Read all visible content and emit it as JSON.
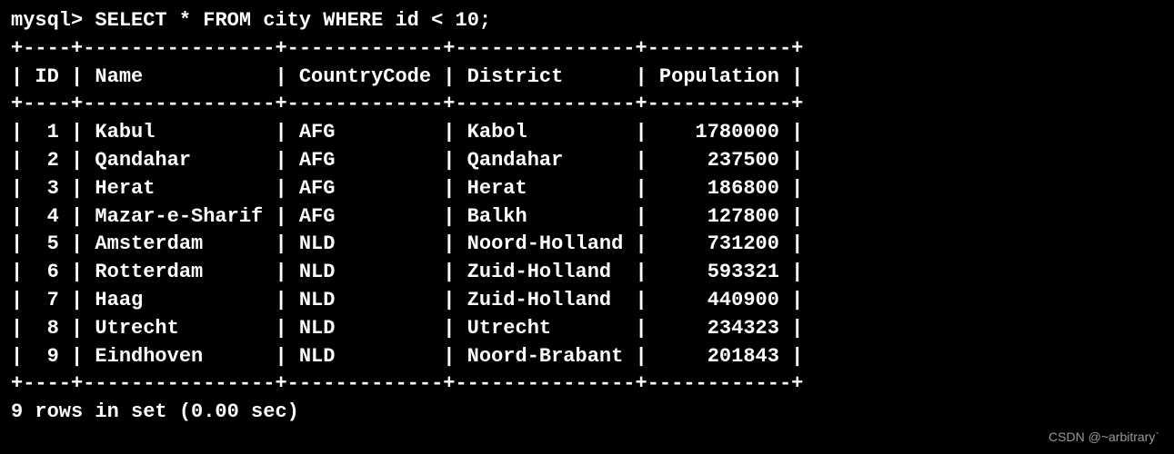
{
  "prompt": "mysql> ",
  "query": "SELECT * FROM city WHERE id < 10;",
  "columns": [
    "ID",
    "Name",
    "CountryCode",
    "District",
    "Population"
  ],
  "rows": [
    {
      "id": "1",
      "name": "Kabul",
      "countrycode": "AFG",
      "district": "Kabol",
      "population": "1780000"
    },
    {
      "id": "2",
      "name": "Qandahar",
      "countrycode": "AFG",
      "district": "Qandahar",
      "population": "237500"
    },
    {
      "id": "3",
      "name": "Herat",
      "countrycode": "AFG",
      "district": "Herat",
      "population": "186800"
    },
    {
      "id": "4",
      "name": "Mazar-e-Sharif",
      "countrycode": "AFG",
      "district": "Balkh",
      "population": "127800"
    },
    {
      "id": "5",
      "name": "Amsterdam",
      "countrycode": "NLD",
      "district": "Noord-Holland",
      "population": "731200"
    },
    {
      "id": "6",
      "name": "Rotterdam",
      "countrycode": "NLD",
      "district": "Zuid-Holland",
      "population": "593321"
    },
    {
      "id": "7",
      "name": "Haag",
      "countrycode": "NLD",
      "district": "Zuid-Holland",
      "population": "440900"
    },
    {
      "id": "8",
      "name": "Utrecht",
      "countrycode": "NLD",
      "district": "Utrecht",
      "population": "234323"
    },
    {
      "id": "9",
      "name": "Eindhoven",
      "countrycode": "NLD",
      "district": "Noord-Brabant",
      "population": "201843"
    }
  ],
  "summary": "9 rows in set (0.00 sec)",
  "widths": {
    "id": 4,
    "name": 16,
    "countrycode": 13,
    "district": 15,
    "population": 12
  },
  "watermark": "CSDN @~arbitrary`",
  "chart_data": {
    "type": "table",
    "title": "city",
    "columns": [
      "ID",
      "Name",
      "CountryCode",
      "District",
      "Population"
    ],
    "rows": [
      [
        1,
        "Kabul",
        "AFG",
        "Kabol",
        1780000
      ],
      [
        2,
        "Qandahar",
        "AFG",
        "Qandahar",
        237500
      ],
      [
        3,
        "Herat",
        "AFG",
        "Herat",
        186800
      ],
      [
        4,
        "Mazar-e-Sharif",
        "AFG",
        "Balkh",
        127800
      ],
      [
        5,
        "Amsterdam",
        "NLD",
        "Noord-Holland",
        731200
      ],
      [
        6,
        "Rotterdam",
        "NLD",
        "Zuid-Holland",
        593321
      ],
      [
        7,
        "Haag",
        "NLD",
        "Zuid-Holland",
        440900
      ],
      [
        8,
        "Utrecht",
        "NLD",
        "Utrecht",
        234323
      ],
      [
        9,
        "Eindhoven",
        "NLD",
        "Noord-Brabant",
        201843
      ]
    ]
  }
}
